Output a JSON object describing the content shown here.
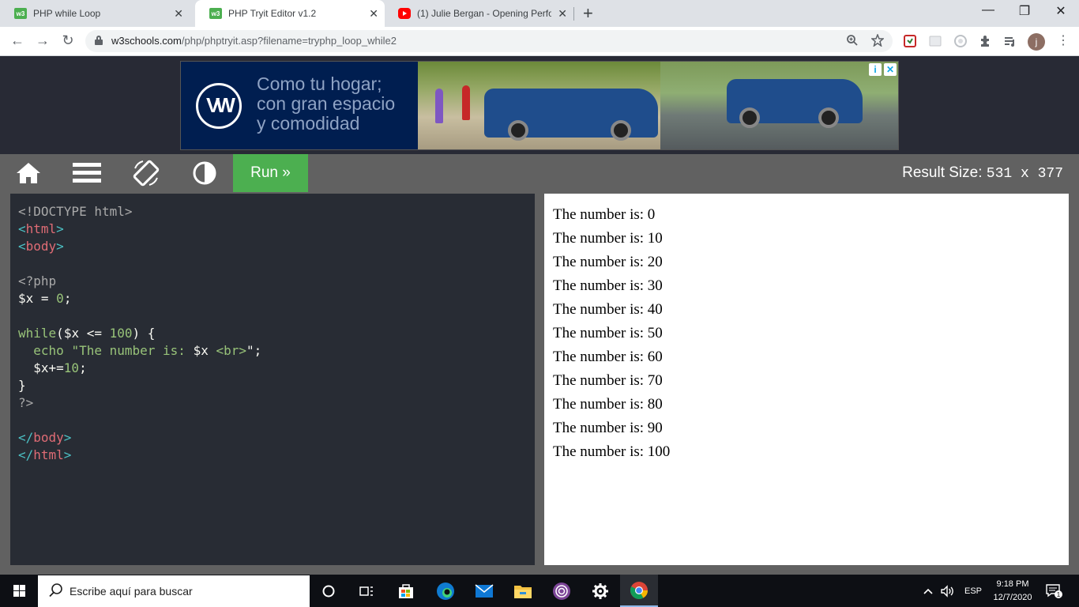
{
  "browser": {
    "tabs": [
      {
        "title": "PHP while Loop",
        "favicon": "w3schools-icon",
        "active": false
      },
      {
        "title": "PHP Tryit Editor v1.2",
        "favicon": "w3schools-icon",
        "active": true
      },
      {
        "title": "(1) Julie Bergan - Opening Perfor",
        "favicon": "youtube-icon",
        "active": false
      }
    ],
    "tab_close": "✕",
    "new_tab": "+",
    "window_controls": {
      "minimize": "—",
      "restore": "❐",
      "close": "✕"
    },
    "nav": {
      "back": "←",
      "forward": "→",
      "reload": "↻"
    },
    "url_host": "w3schools.com",
    "url_path": "/php/phptryit.asp?filename=tryphp_loop_while2",
    "profile_initial": "j",
    "menu": "⋮"
  },
  "ad": {
    "brand": "VW",
    "lines": [
      "Como tu hogar;",
      "con gran espacio",
      "y comodidad"
    ],
    "adchoices": [
      "i",
      "✕"
    ]
  },
  "tryit": {
    "run_label": "Run »",
    "result_size_label": "Result Size:",
    "result_size_value": "531 x 377"
  },
  "code": {
    "lines": [
      [
        {
          "t": "<!DOCTYPE html>",
          "c": "c-doc"
        }
      ],
      [
        {
          "t": "<",
          "c": "c-br"
        },
        {
          "t": "html",
          "c": "c-tag"
        },
        {
          "t": ">",
          "c": "c-br"
        }
      ],
      [
        {
          "t": "<",
          "c": "c-br"
        },
        {
          "t": "body",
          "c": "c-tag"
        },
        {
          "t": ">",
          "c": "c-br"
        }
      ],
      [],
      [
        {
          "t": "<?php",
          "c": "c-php"
        }
      ],
      [
        {
          "t": "$x",
          "c": "c-var"
        },
        {
          "t": " = ",
          "c": "c-op"
        },
        {
          "t": "0",
          "c": "c-num"
        },
        {
          "t": ";",
          "c": "c-op"
        }
      ],
      [],
      [
        {
          "t": "while",
          "c": "c-kw"
        },
        {
          "t": "(",
          "c": "c-op"
        },
        {
          "t": "$x",
          "c": "c-var"
        },
        {
          "t": " <= ",
          "c": "c-op"
        },
        {
          "t": "100",
          "c": "c-num"
        },
        {
          "t": ") {",
          "c": "c-op"
        }
      ],
      [
        {
          "t": "  echo ",
          "c": "c-kw"
        },
        {
          "t": "\"The number is: ",
          "c": "c-str"
        },
        {
          "t": "$x",
          "c": "c-var"
        },
        {
          "t": " <br>",
          "c": "c-str"
        },
        {
          "t": "\";",
          "c": "c-op"
        }
      ],
      [
        {
          "t": "  $x",
          "c": "c-var"
        },
        {
          "t": "+=",
          "c": "c-op"
        },
        {
          "t": "10",
          "c": "c-num"
        },
        {
          "t": ";",
          "c": "c-op"
        }
      ],
      [
        {
          "t": "}",
          "c": "c-op"
        }
      ],
      [
        {
          "t": "?>",
          "c": "c-php"
        }
      ],
      [],
      [
        {
          "t": "</",
          "c": "c-br"
        },
        {
          "t": "body",
          "c": "c-tag"
        },
        {
          "t": ">",
          "c": "c-br"
        }
      ],
      [
        {
          "t": "</",
          "c": "c-br"
        },
        {
          "t": "html",
          "c": "c-tag"
        },
        {
          "t": ">",
          "c": "c-br"
        }
      ]
    ]
  },
  "result": {
    "lines": [
      "The number is: 0",
      "The number is: 10",
      "The number is: 20",
      "The number is: 30",
      "The number is: 40",
      "The number is: 50",
      "The number is: 60",
      "The number is: 70",
      "The number is: 80",
      "The number is: 90",
      "The number is: 100"
    ]
  },
  "taskbar": {
    "search_placeholder": "Escribe aquí para buscar",
    "language": "ESP",
    "time": "9:18 PM",
    "date": "12/7/2020",
    "notification_count": "1"
  },
  "colors": {
    "run_green": "#4caf50",
    "editor_bg": "#282c34",
    "toolbar_gray": "#616161"
  }
}
